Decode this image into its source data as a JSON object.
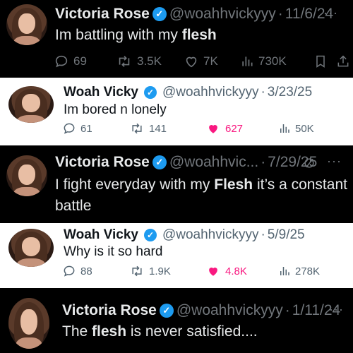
{
  "tweets": [
    {
      "name": "Victoria Rose",
      "handle": "@woahhvickyyy",
      "date": "11/6/24",
      "text_parts": [
        "Im battling with my ",
        "flesh"
      ],
      "replies": "69",
      "reposts": "3.5K",
      "likes": "7K",
      "views": "730K"
    },
    {
      "name": "Woah Vicky",
      "handle": "@woahhvickyyy",
      "date": "3/23/25",
      "text": "Im bored n lonely",
      "replies": "61",
      "reposts": "141",
      "likes": "627",
      "views": "50K",
      "liked": true
    },
    {
      "name": "Victoria Rose",
      "handle": "@woahhvic...",
      "date": "7/29/25",
      "text_line1_parts": [
        "I fight everyday with my ",
        "Flesh",
        " it’s a constant"
      ],
      "text_line2": "battle"
    },
    {
      "name": "Woah Vicky",
      "handle": "@woahhvickyyy",
      "date": "5/9/25",
      "text": "Why is it so hard",
      "replies": "88",
      "reposts": "1.9K",
      "likes": "4.8K",
      "views": "278K",
      "liked": true
    },
    {
      "name": "Victoria Rose",
      "handle": "@woahhvickyyy",
      "date": "1/11/24",
      "text_parts": [
        "The ",
        "flesh",
        " is never satisfied...."
      ]
    }
  ],
  "more_glyph": "···",
  "dot": "·",
  "verified_glyph": "✓",
  "colors": {
    "verified": "#1d9bf0",
    "like": "#f91880",
    "muted_dark": "#71767b",
    "muted_light": "#536471"
  },
  "icons": [
    "reply-icon",
    "repost-icon",
    "like-icon",
    "views-icon",
    "bookmark-icon",
    "share-icon",
    "edit-icon",
    "more-icon",
    "verified-badge-icon"
  ]
}
